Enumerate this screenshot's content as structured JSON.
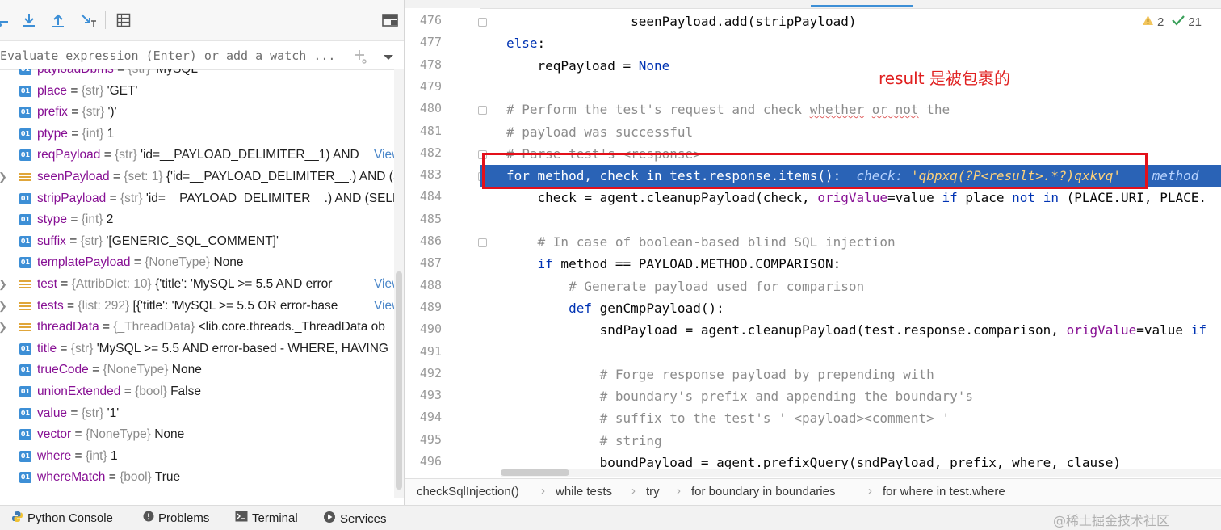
{
  "debugger": {
    "toolbar": [
      "step-over-icon",
      "step-into-icon",
      "step-out-icon",
      "run-to-cursor-icon",
      "evaluate-table-icon",
      "layout-icon"
    ],
    "watch_placeholder": "Evaluate expression (Enter) or add a watch ...",
    "variables": [
      {
        "name": "payloadDbms",
        "type": "{str}",
        "value": "'MySQL'",
        "icon": "01",
        "expandable": false
      },
      {
        "name": "place",
        "type": "{str}",
        "value": "'GET'",
        "icon": "01",
        "expandable": false
      },
      {
        "name": "prefix",
        "type": "{str}",
        "value": "')'",
        "icon": "01",
        "expandable": false
      },
      {
        "name": "ptype",
        "type": "{int}",
        "value": "1",
        "icon": "01",
        "expandable": false
      },
      {
        "name": "reqPayload",
        "type": "{str}",
        "value": "'id=__PAYLOAD_DELIMITER__1) AND",
        "icon": "01",
        "expandable": false,
        "view": "View"
      },
      {
        "name": "seenPayload",
        "type": "{set: 1}",
        "value": "{'id=__PAYLOAD_DELIMITER__.) AND (S",
        "icon": "list",
        "expandable": true
      },
      {
        "name": "stripPayload",
        "type": "{str}",
        "value": "'id=__PAYLOAD_DELIMITER__.) AND (SELEC",
        "icon": "01",
        "expandable": false
      },
      {
        "name": "stype",
        "type": "{int}",
        "value": "2",
        "icon": "01",
        "expandable": false
      },
      {
        "name": "suffix",
        "type": "{str}",
        "value": "'[GENERIC_SQL_COMMENT]'",
        "icon": "01",
        "expandable": false
      },
      {
        "name": "templatePayload",
        "type": "{NoneType}",
        "value": "None",
        "icon": "01",
        "expandable": false
      },
      {
        "name": "test",
        "type": "{AttribDict: 10}",
        "value": "{'title': 'MySQL >= 5.5 AND error",
        "icon": "list",
        "expandable": true,
        "view": "View"
      },
      {
        "name": "tests",
        "type": "{list: 292}",
        "value": "[{'title': 'MySQL >= 5.5 OR error-base",
        "icon": "list",
        "expandable": true,
        "view": "View"
      },
      {
        "name": "threadData",
        "type": "{_ThreadData}",
        "value": "<lib.core.threads._ThreadData ob",
        "icon": "list",
        "expandable": true
      },
      {
        "name": "title",
        "type": "{str}",
        "value": "'MySQL >= 5.5 AND error-based - WHERE, HAVING",
        "icon": "01",
        "expandable": false
      },
      {
        "name": "trueCode",
        "type": "{NoneType}",
        "value": "None",
        "icon": "01",
        "expandable": false
      },
      {
        "name": "unionExtended",
        "type": "{bool}",
        "value": "False",
        "icon": "01",
        "expandable": false
      },
      {
        "name": "value",
        "type": "{str}",
        "value": "'1'",
        "icon": "01",
        "expandable": false
      },
      {
        "name": "vector",
        "type": "{NoneType}",
        "value": "None",
        "icon": "01",
        "expandable": false
      },
      {
        "name": "where",
        "type": "{int}",
        "value": "1",
        "icon": "01",
        "expandable": false
      },
      {
        "name": "whereMatch",
        "type": "{bool}",
        "value": "True",
        "icon": "01",
        "expandable": false
      }
    ]
  },
  "editor": {
    "inspections": {
      "warnings": "2",
      "ok": "21"
    },
    "annotation": "result 是被包裹的",
    "lines": [
      {
        "no": "476",
        "code": "                seenPayload.add(stripPayload)"
      },
      {
        "no": "477",
        "code": "else:",
        "kw": true
      },
      {
        "no": "478",
        "code": "    reqPayload = None"
      },
      {
        "no": "479",
        "code": ""
      },
      {
        "no": "480",
        "code": "# Perform the test's request and check whether or not the",
        "comment": true
      },
      {
        "no": "481",
        "code": "# payload was successful",
        "comment": true
      },
      {
        "no": "482",
        "code": "# Parse test's <response>",
        "comment": true
      },
      {
        "no": "483",
        "code": "for method, check in test.response.items():",
        "highlight": true,
        "inlay_label": "check: ",
        "inlay_value": "'qbpxq(?P<result>.*?)qxkvq'",
        "inlay_tail": "method"
      },
      {
        "no": "484",
        "code": "    check = agent.cleanupPayload(check, origValue=value if place not in (PLACE.URI, PLACE."
      },
      {
        "no": "485",
        "code": ""
      },
      {
        "no": "486",
        "code": "    # In case of boolean-based blind SQL injection",
        "comment": true
      },
      {
        "no": "487",
        "code": "    if method == PAYLOAD.METHOD.COMPARISON:"
      },
      {
        "no": "488",
        "code": "        # Generate payload used for comparison",
        "comment": true
      },
      {
        "no": "489",
        "code": "        def genCmpPayload():"
      },
      {
        "no": "490",
        "code": "            sndPayload = agent.cleanupPayload(test.response.comparison, origValue=value if"
      },
      {
        "no": "491",
        "code": ""
      },
      {
        "no": "492",
        "code": "            # Forge response payload by prepending with",
        "comment": true
      },
      {
        "no": "493",
        "code": "            # boundary's prefix and appending the boundary's",
        "comment": true
      },
      {
        "no": "494",
        "code": "            # suffix to the test's ' <payload><comment> '",
        "comment": true
      },
      {
        "no": "495",
        "code": "            # string",
        "comment": true
      },
      {
        "no": "496",
        "code": "            boundPayload = agent.prefixQuery(sndPayload, prefix, where, clause)"
      }
    ],
    "breadcrumbs": [
      "checkSqlInjection()",
      "while tests",
      "try",
      "for boundary in boundaries",
      "for where in test.where"
    ]
  },
  "bottom_bar": {
    "items": [
      {
        "label": "Python Console",
        "icon": "python-icon"
      },
      {
        "label": "Problems",
        "icon": "problems-icon"
      },
      {
        "label": "Terminal",
        "icon": "terminal-icon"
      },
      {
        "label": "Services",
        "icon": "services-icon"
      }
    ],
    "watermark": "@稀土掘金技术社区"
  },
  "colors": {
    "accent": "#2a63b6",
    "annotation": "#e02020",
    "keyword": "#0033b3",
    "comment": "#8c8c8c",
    "param": "#871094"
  }
}
